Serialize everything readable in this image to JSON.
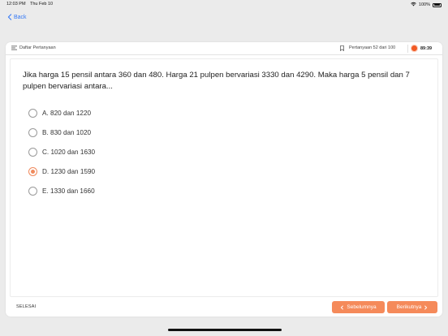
{
  "status_bar": {
    "time": "12:03 PM",
    "date": "Thu Feb 10",
    "battery": "100%"
  },
  "nav": {
    "back_label": "Back"
  },
  "header": {
    "list_label": "Daftar Pertanyaan",
    "progress_label": "Pertanyaan 52 dari 100",
    "timer": "89:39"
  },
  "question": {
    "text": "Jika harga 15 pensil antara 360 dan 480. Harga 21 pulpen bervariasi 3330 dan 4290. Maka harga 5 pensil dan 7 pulpen bervariasi antara...",
    "options": [
      {
        "label": "A. 820 dan 1220",
        "selected": false
      },
      {
        "label": "B. 830 dan 1020",
        "selected": false
      },
      {
        "label": "C. 1020 dan 1630",
        "selected": false
      },
      {
        "label": "D. 1230 dan 1590",
        "selected": true
      },
      {
        "label": "E. 1330 dan 1660",
        "selected": false
      }
    ]
  },
  "footer": {
    "finish_label": "SELESAI",
    "prev_label": "Sebelumnya",
    "next_label": "Berikutnya"
  },
  "colors": {
    "accent": "#f58a5a",
    "link": "#3478f6",
    "timer_dot": "#f15a24"
  },
  "icons": [
    "wifi-icon",
    "battery-icon",
    "chevron-left-icon",
    "list-icon",
    "bookmark-icon",
    "chevron-right-icon"
  ]
}
